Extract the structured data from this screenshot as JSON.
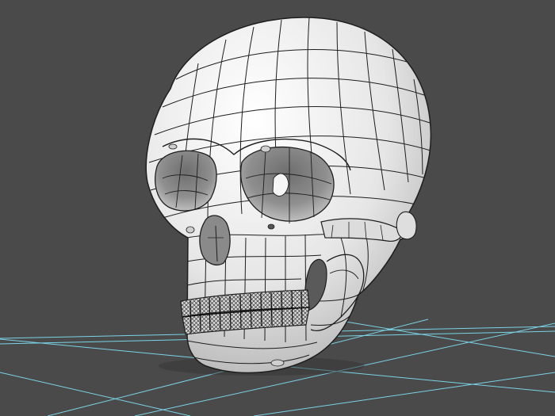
{
  "viewport": {
    "background_color": "#4a4a4a",
    "grid_color": "#7ad3e6",
    "mesh_fill_color": "#e9e9e9",
    "wire_color": "#1e1e1e",
    "shadow_color": "#333333",
    "shading": "smooth-shaded-with-wireframe",
    "model": "skull-mesh",
    "ground": "ground-grid"
  }
}
